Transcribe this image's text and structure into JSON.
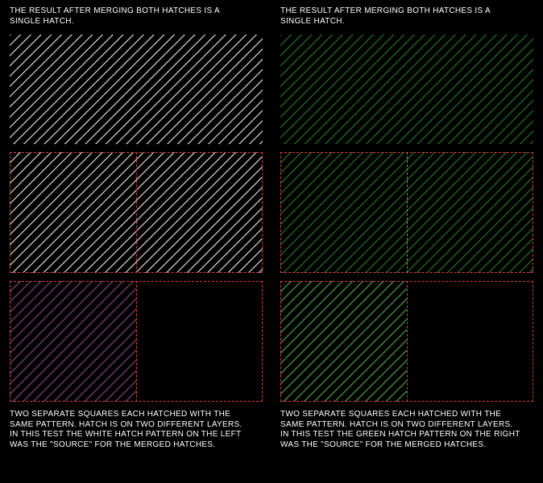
{
  "colors": {
    "white": "#dcdcdc",
    "green": "#1f7a1f",
    "purple": "#5a1a5a",
    "borderRed": "#d94040",
    "borderGold": "#b88b30"
  },
  "captions": {
    "top": "THE RESULT AFTER MERGING BOTH HATCHES IS A\nSINGLE HATCH.",
    "leftBottom": "TWO SEPARATE SQUARES EACH HATCHED WITH THE\nSAME PATTERN.  HATCH IS ON TWO DIFFERENT LAYERS.\nIN THIS TEST THE WHITE HATCH PATTERN ON THE LEFT\nWAS THE \"SOURCE\" FOR THE MERGED HATCHES.",
    "rightBottom": "TWO SEPARATE SQUARES EACH HATCHED WITH THE\nSAME PATTERN.  HATCH IS ON TWO DIFFERENT LAYERS.\nIN THIS TEST THE GREEN HATCH PATTERN ON THE RIGHT\nWAS THE \"SOURCE\" FOR THE MERGED HATCHES."
  },
  "panels": {
    "left": {
      "top": {
        "fill": "white",
        "border": null
      },
      "middle": {
        "fill": "white",
        "border": "borderRed",
        "divider": "borderRed"
      },
      "bottom": {
        "left": "white",
        "right": "purple",
        "border": "borderRed",
        "divider": "borderRed"
      }
    },
    "right": {
      "top": {
        "fill": "green",
        "border": null
      },
      "middle": {
        "fill": "green",
        "border": "borderRed",
        "divider": "borderGold"
      },
      "bottom": {
        "left": "white",
        "right": "green",
        "border": "borderRed",
        "divider": "borderRed"
      }
    }
  }
}
